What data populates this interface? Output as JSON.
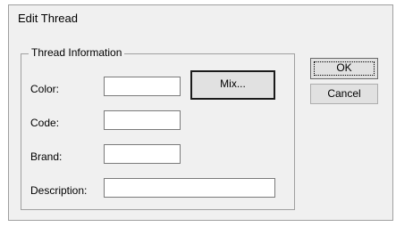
{
  "dialog": {
    "title": "Edit Thread"
  },
  "group": {
    "legend": "Thread Information",
    "fields": {
      "color_label": "Color:",
      "color_value": "",
      "code_label": "Code:",
      "code_value": "",
      "brand_label": "Brand:",
      "brand_value": "",
      "description_label": "Description:",
      "description_value": ""
    },
    "mix_button": "Mix..."
  },
  "buttons": {
    "ok": "OK",
    "cancel": "Cancel"
  },
  "colors": {
    "dialog_bg": "#f0f0f0",
    "field_bg": "#ffffff",
    "button_bg": "#e1e1e1"
  }
}
